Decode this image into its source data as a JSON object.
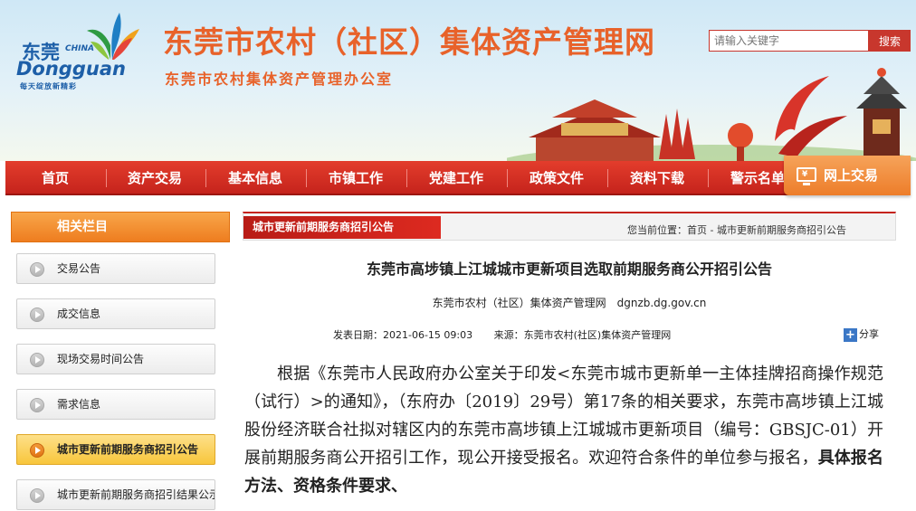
{
  "header": {
    "logo": {
      "cn": "东莞",
      "china": "CHINA",
      "en": "Dongguan",
      "slogan": "每天绽放新精彩"
    },
    "title": "东莞市农村（社区）集体资产管理网",
    "subtitle": "东莞市农村集体资产管理办公室",
    "search": {
      "placeholder": "请输入关键字",
      "button": "搜索"
    }
  },
  "nav": {
    "items": [
      "首页",
      "资产交易",
      "基本信息",
      "市镇工作",
      "党建工作",
      "政策文件",
      "资料下载",
      "警示名单"
    ],
    "online_trade": "网上交易"
  },
  "sidebar": {
    "heading": "相关栏目",
    "items": [
      {
        "label": "交易公告"
      },
      {
        "label": "成交信息"
      },
      {
        "label": "现场交易时间公告"
      },
      {
        "label": "需求信息"
      },
      {
        "label": "城市更新前期服务商招引公告"
      },
      {
        "label": "城市更新前期服务商招引结果公示"
      }
    ],
    "active_index": 4
  },
  "content": {
    "section_tag": "城市更新前期服务商招引公告",
    "location_label": "您当前位置：",
    "location_path": "首页 - 城市更新前期服务商招引公告",
    "article": {
      "title": "东莞市高埗镇上江城城市更新项目选取前期服务商公开招引公告",
      "source_line": "东莞市农村（社区）集体资产管理网　dgnzb.dg.gov.cn",
      "publish_label": "发表日期：",
      "publish_date": "2021-06-15 09:03",
      "from_label": "来源：",
      "from_value": "东莞市农村(社区)集体资产管理网",
      "share": "分享",
      "body_plain": "根据《东莞市人民政府办公室关于印发<东莞市城市更新单一主体挂牌招商操作规范（试行）>的通知》，（东府办〔2019〕29号）第17条的相关要求，东莞市高埗镇上江城股份经济联合社拟对辖区内的东莞市高埗镇上江城城市更新项目（编号：GBSJC-01）开展前期服务商公开招引工作，现公开接受报名。欢迎符合条件的单位参与报名，",
      "body_bold": "具体报名方法、资格条件要求、"
    }
  },
  "colors": {
    "brand_red": "#c5231c",
    "brand_orange": "#e8622a",
    "accent_yellow": "#f8c63c"
  }
}
